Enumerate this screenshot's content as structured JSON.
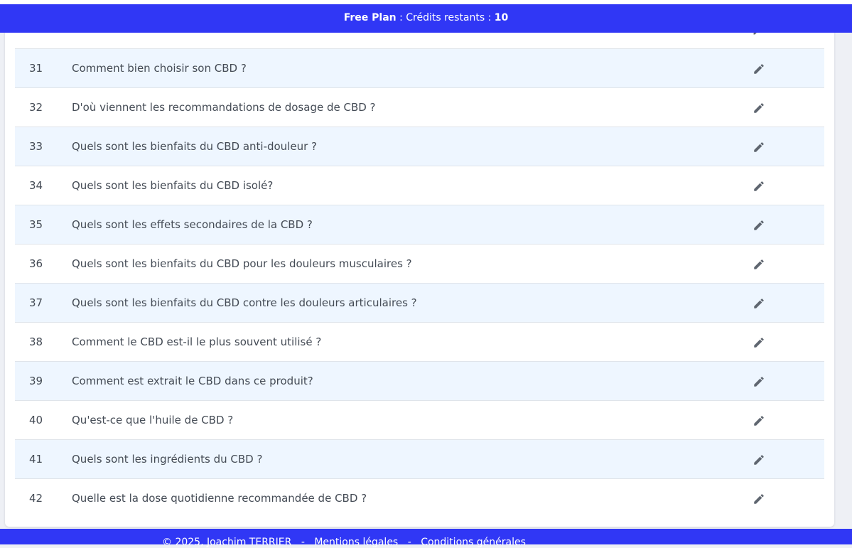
{
  "banner": {
    "plan_label": "Free Plan",
    "credits_text": " : Crédits restants : ",
    "credits_value": "10"
  },
  "questions": [
    {
      "num": "31",
      "text": "Comment bien choisir son CBD ?"
    },
    {
      "num": "32",
      "text": "D'où viennent les recommandations de dosage de CBD ?"
    },
    {
      "num": "33",
      "text": "Quels sont les bienfaits du CBD anti-douleur ?"
    },
    {
      "num": "34",
      "text": "Quels sont les bienfaits du CBD isolé?"
    },
    {
      "num": "35",
      "text": "Quels sont les effets secondaires de la CBD ?"
    },
    {
      "num": "36",
      "text": "Quels sont les bienfaits du CBD pour les douleurs musculaires ?"
    },
    {
      "num": "37",
      "text": "Quels sont les bienfaits du CBD contre les douleurs articulaires ?"
    },
    {
      "num": "38",
      "text": "Comment le CBD est-il le plus souvent utilisé ?"
    },
    {
      "num": "39",
      "text": "Comment est extrait le CBD dans ce produit?"
    },
    {
      "num": "40",
      "text": "Qu'est-ce que l'huile de CBD ?"
    },
    {
      "num": "41",
      "text": "Quels sont les ingrédients du CBD ?"
    },
    {
      "num": "42",
      "text": "Quelle est la dose quotidienne recommandée de CBD ?"
    }
  ],
  "icons": {
    "edit": "pencil-icon"
  },
  "footer": {
    "copyright": "© 2025, Joachim TERRIER",
    "separator": "-",
    "legal_link": "Mentions légales",
    "terms_link": "Conditions générales"
  },
  "colors": {
    "accent": "#3037f5",
    "row_alt": "#eef6ff",
    "text": "#444b55",
    "icon": "#5f6670"
  }
}
